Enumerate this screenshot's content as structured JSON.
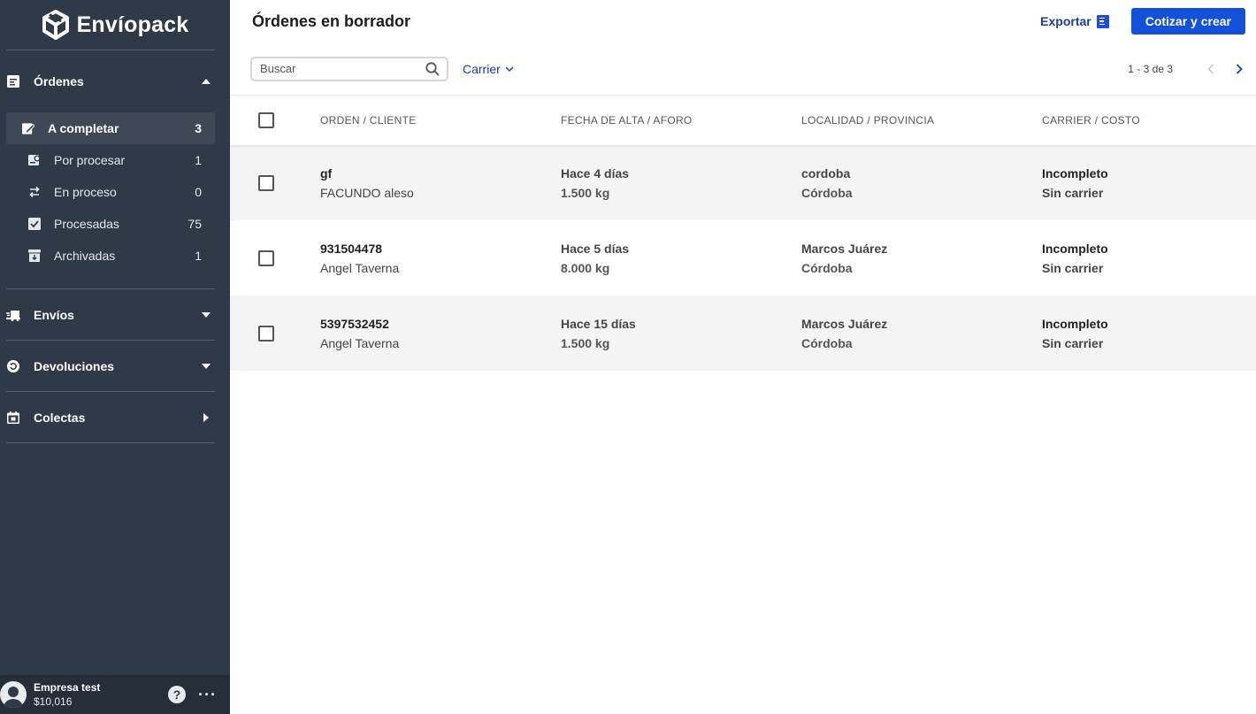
{
  "brand": {
    "name": "Envíopack"
  },
  "sidebar": {
    "sections": [
      {
        "label": "Órdenes",
        "expanded": true,
        "items": [
          {
            "label": "A completar",
            "count": "3",
            "active": true
          },
          {
            "label": "Por procesar",
            "count": "1"
          },
          {
            "label": "En proceso",
            "count": "0"
          },
          {
            "label": "Procesadas",
            "count": "75"
          },
          {
            "label": "Archivadas",
            "count": "1"
          }
        ]
      },
      {
        "label": "Envíos"
      },
      {
        "label": "Devoluciones"
      },
      {
        "label": "Colectas"
      }
    ],
    "footer": {
      "company": "Empresa test",
      "balance": "$10,016",
      "help": "?",
      "more": "···"
    }
  },
  "header": {
    "title": "Órdenes en borrador",
    "export_label": "Exportar",
    "primary_label": "Cotizar y crear"
  },
  "filters": {
    "search_placeholder": "Buscar",
    "carrier_label": "Carrier",
    "pagination": "1 - 3 de 3"
  },
  "table": {
    "columns": [
      "ORDEN / CLIENTE",
      "FECHA DE ALTA / AFORO",
      "LOCALIDAD / PROVINCIA",
      "CARRIER / COSTO"
    ],
    "rows": [
      {
        "order": "gf",
        "client": "FACUNDO aleso",
        "date": "Hace 4 días",
        "weight": "1.500 kg",
        "city": "cordoba",
        "province": "Córdoba",
        "status": "Incompleto",
        "carrier": "Sin carrier"
      },
      {
        "order": "931504478",
        "client": "Angel Taverna",
        "date": "Hace 5 días",
        "weight": "8.000 kg",
        "city": "Marcos Juárez",
        "province": "Córdoba",
        "status": "Incompleto",
        "carrier": "Sin carrier"
      },
      {
        "order": "5397532452",
        "client": "Angel Taverna",
        "date": "Hace 15 días",
        "weight": "1.500 kg",
        "city": "Marcos Juárez",
        "province": "Córdoba",
        "status": "Incompleto",
        "carrier": "Sin carrier"
      }
    ]
  },
  "colors": {
    "sidebar": "#2f3a48",
    "primary": "#1450d8",
    "link": "#1c3aa8",
    "status": "#9a7a1c"
  },
  "icons": [
    "logo-cube-icon",
    "orders-icon",
    "edit-icon",
    "clipboard-icon",
    "swap-icon",
    "check-icon",
    "archive-icon",
    "truck-icon",
    "return-icon",
    "calendar-icon",
    "search-icon",
    "chevron-down-icon",
    "chevron-left-icon",
    "chevron-right-icon",
    "export-icon",
    "user-icon"
  ]
}
